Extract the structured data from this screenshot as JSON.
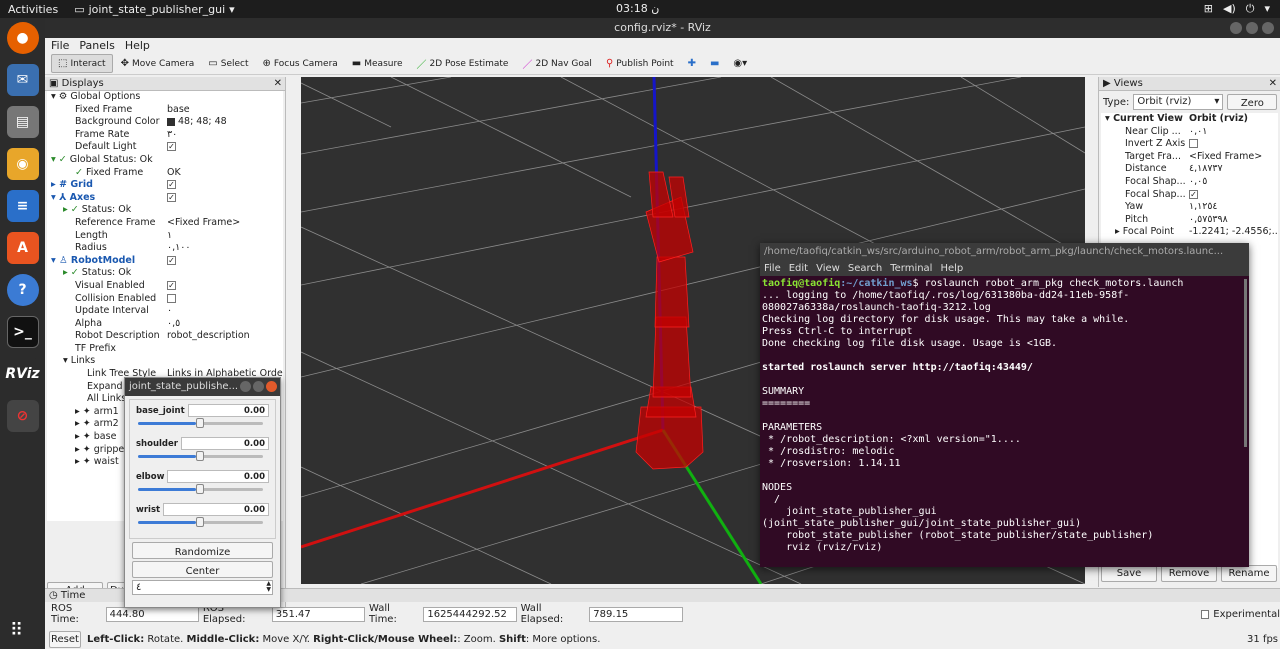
{
  "topbar": {
    "activities": "Activities",
    "app": "joint_state_publisher_gui",
    "clock": "03:18 ن"
  },
  "window": {
    "title": "config.rviz* - RViz",
    "menu": [
      "File",
      "Panels",
      "Help"
    ]
  },
  "toolbar": {
    "interact": "Interact",
    "move_camera": "Move Camera",
    "select": "Select",
    "focus_camera": "Focus Camera",
    "measure": "Measure",
    "pose_estimate": "2D Pose Estimate",
    "nav_goal": "2D Nav Goal",
    "publish_point": "Publish Point"
  },
  "displays": {
    "title": "Displays",
    "rows": [
      {
        "k": "Global Options",
        "v": ""
      },
      {
        "k": "Fixed Frame",
        "v": "base"
      },
      {
        "k": "Background Color",
        "v": "48; 48; 48"
      },
      {
        "k": "Frame Rate",
        "v": "٣٠"
      },
      {
        "k": "Default Light",
        "v": ""
      },
      {
        "k": "Global Status: Ok",
        "v": ""
      },
      {
        "k": "Fixed Frame",
        "v": "OK"
      },
      {
        "k": "Grid",
        "v": ""
      },
      {
        "k": "Axes",
        "v": ""
      },
      {
        "k": "Status: Ok",
        "v": ""
      },
      {
        "k": "Reference Frame",
        "v": "<Fixed Frame>"
      },
      {
        "k": "Length",
        "v": "١"
      },
      {
        "k": "Radius",
        "v": "٠,١٠٠"
      },
      {
        "k": "RobotModel",
        "v": ""
      },
      {
        "k": "Status: Ok",
        "v": ""
      },
      {
        "k": "Visual Enabled",
        "v": ""
      },
      {
        "k": "Collision Enabled",
        "v": ""
      },
      {
        "k": "Update Interval",
        "v": "٠"
      },
      {
        "k": "Alpha",
        "v": "٠,٥"
      },
      {
        "k": "Robot Description",
        "v": "robot_description"
      },
      {
        "k": "TF Prefix",
        "v": ""
      },
      {
        "k": "Links",
        "v": ""
      },
      {
        "k": "Link Tree Style",
        "v": "Links in Alphabetic Order"
      },
      {
        "k": "Expand Link Details",
        "v": ""
      },
      {
        "k": "All Links Enabled",
        "v": ""
      },
      {
        "k": "arm1",
        "v": ""
      },
      {
        "k": "arm2",
        "v": ""
      },
      {
        "k": "base",
        "v": ""
      },
      {
        "k": "gripper",
        "v": ""
      },
      {
        "k": "waist",
        "v": ""
      }
    ],
    "add_label": "Add",
    "dup_label": "Du"
  },
  "views": {
    "title": "Views",
    "type_label": "Type:",
    "type_value": "Orbit (rviz)",
    "zero_label": "Zero",
    "rows": [
      {
        "k": "Current View",
        "v": "Orbit (rviz)"
      },
      {
        "k": "Near Clip ...",
        "v": "٠,٠١"
      },
      {
        "k": "Invert Z Axis",
        "v": ""
      },
      {
        "k": "Target Fra...",
        "v": "<Fixed Frame>"
      },
      {
        "k": "Distance",
        "v": "٤,١٨٧٣٧"
      },
      {
        "k": "Focal Shap...",
        "v": "٠,٠٥"
      },
      {
        "k": "Focal Shap...",
        "v": ""
      },
      {
        "k": "Yaw",
        "v": "١,١٢٥٤"
      },
      {
        "k": "Pitch",
        "v": "٠,٥٧٥٣٩٨"
      },
      {
        "k": "Focal Point",
        "v": "-1.2241; -2.4556;..."
      }
    ],
    "save_label": "Save",
    "remove_label": "Remove",
    "rename_label": "Rename"
  },
  "time": {
    "title": "Time",
    "ros_time_label": "ROS Time:",
    "ros_time": "444.80",
    "ros_elapsed_label": "ROS Elapsed:",
    "ros_elapsed": "351.47",
    "wall_time_label": "Wall Time:",
    "wall_time": "1625444292.52",
    "wall_elapsed_label": "Wall Elapsed:",
    "wall_elapsed": "789.15",
    "experimental": "Experimental"
  },
  "status": {
    "reset": "Reset",
    "left": "Left-Click:",
    "left_t": " Rotate. ",
    "middle": "Middle-Click:",
    "middle_t": " Move X/Y. ",
    "right": "Right-Click/Mouse Wheel:",
    "right_t": ": Zoom. ",
    "shift": "Shift",
    "shift_t": ": More options.",
    "fps": "31 fps"
  },
  "jsp": {
    "title": "joint_state_publishe...",
    "joints": [
      {
        "name": "base_joint",
        "value": "0.00",
        "pos": 0.5
      },
      {
        "name": "shoulder",
        "value": "0.00",
        "pos": 0.5
      },
      {
        "name": "elbow",
        "value": "0.00",
        "pos": 0.5
      },
      {
        "name": "wrist",
        "value": "0.00",
        "pos": 0.5
      }
    ],
    "randomize": "Randomize",
    "center": "Center",
    "spin_value": "٤"
  },
  "terminal": {
    "title": "/home/taofiq/catkin_ws/src/arduino_robot_arm/robot_arm_pkg/launch/check_motors.launc...",
    "menu": [
      "File",
      "Edit",
      "View",
      "Search",
      "Terminal",
      "Help"
    ],
    "prompt_user": "taofiq@taofiq",
    "prompt_path": ":~/catkin_ws",
    "command": "$ roslaunch robot_arm_pkg check_motors.launch",
    "lines": [
      "... logging to /home/taofiq/.ros/log/631380ba-dd24-11eb-958f-080027a6338a/roslaunch-taofiq-3212.log",
      "Checking log directory for disk usage. This may take a while.",
      "Press Ctrl-C to interrupt",
      "Done checking log file disk usage. Usage is <1GB.",
      "",
      "started roslaunch server http://taofiq:43449/",
      "",
      "SUMMARY",
      "========",
      "",
      "PARAMETERS",
      " * /robot_description: <?xml version=\"1....",
      " * /rosdistro: melodic",
      " * /rosversion: 1.14.11",
      "",
      "NODES",
      "  /",
      "    joint_state_publisher_gui (joint_state_publisher_gui/joint_state_publisher_gui)",
      "    robot_state_publisher (robot_state_publisher/state_publisher)",
      "    rviz (rviz/rviz)"
    ]
  }
}
